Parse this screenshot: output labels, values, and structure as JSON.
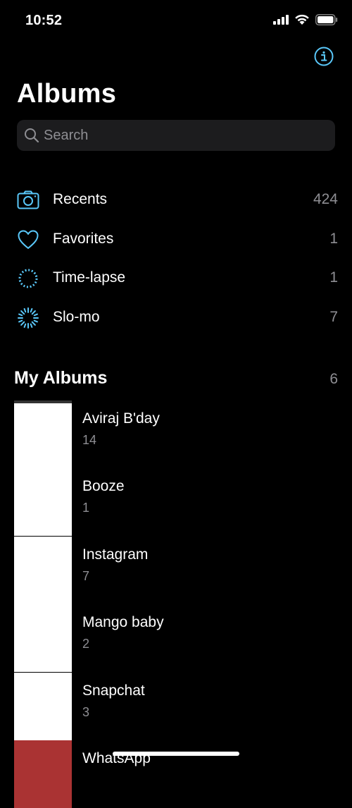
{
  "status_bar": {
    "time": "10:52",
    "icons": [
      "cellular-signal-icon",
      "wifi-icon",
      "battery-icon"
    ]
  },
  "header": {
    "title": "Albums",
    "info_icon": "info-icon"
  },
  "search": {
    "placeholder": "Search",
    "value": ""
  },
  "media_types": [
    {
      "label": "Recents",
      "count": "424",
      "icon": "camera-icon"
    },
    {
      "label": "Favorites",
      "count": "1",
      "icon": "heart-icon"
    },
    {
      "label": "Time-lapse",
      "count": "1",
      "icon": "time-lapse-icon"
    },
    {
      "label": "Slo-mo",
      "count": "7",
      "icon": "slo-mo-icon"
    }
  ],
  "my_albums": {
    "title": "My Albums",
    "count": "6",
    "albums": [
      {
        "name": "Aviraj B'day",
        "count": "14"
      },
      {
        "name": "Booze",
        "count": "1"
      },
      {
        "name": "Instagram",
        "count": "7"
      },
      {
        "name": "Mango baby",
        "count": "2"
      },
      {
        "name": "Snapchat",
        "count": "3"
      },
      {
        "name": "WhatsApp",
        "count": ""
      }
    ]
  },
  "colors": {
    "accent": "#5ac8fa",
    "background": "#000000",
    "search_bg": "#1c1c1e",
    "secondary_text": "#8e8e93"
  }
}
